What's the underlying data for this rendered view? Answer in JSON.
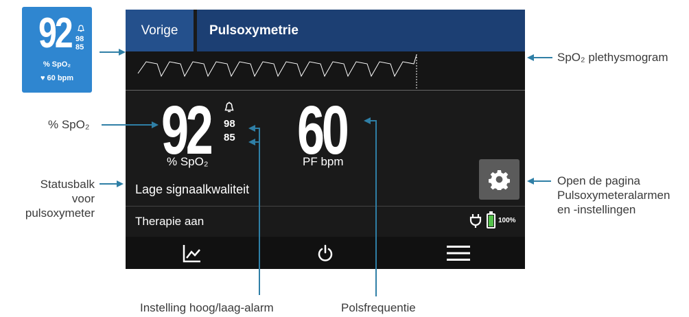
{
  "thumbnail": {
    "spo2_value": "92",
    "alarm_high": "98",
    "alarm_low": "85",
    "spo2_label": "% SpO₂",
    "pulse_label": "♥ 60 bpm"
  },
  "header": {
    "back_label": "Vorige",
    "title": "Pulsoxymetrie"
  },
  "readings": {
    "spo2_value": "92",
    "alarm_high": "98",
    "alarm_low": "85",
    "spo2_unit": "% SpO₂",
    "pulse_value": "60",
    "pulse_unit": "PF bpm"
  },
  "status": {
    "signal_quality": "Lage signaalkwaliteit",
    "therapy": "Therapie aan",
    "battery_percent": "100%",
    "battery_level": 1.0
  },
  "nav": {
    "items": [
      "trends-icon",
      "power-icon",
      "menu-icon"
    ]
  },
  "annotations": {
    "plethysmogram": "SpO₂ plethysmogram",
    "spo2": "% SpO₂",
    "statusbar_line1": "Statusbalk",
    "statusbar_line2": "voor",
    "statusbar_line3": "pulsoxymeter",
    "settings_line1": "Open de pagina",
    "settings_line2": "Pulsoxymeteralarmen",
    "settings_line3": "en -instellingen",
    "alarm_setting": "Instelling hoog/laag-alarm",
    "pulse_rate": "Polsfrequentie"
  },
  "colors": {
    "thumbnail_bg": "#2f86d0",
    "header_bg": "#1c3f73",
    "screen_bg": "#1a1a1a",
    "annotation_line": "#2f7fa6",
    "battery": "#54c04b"
  }
}
